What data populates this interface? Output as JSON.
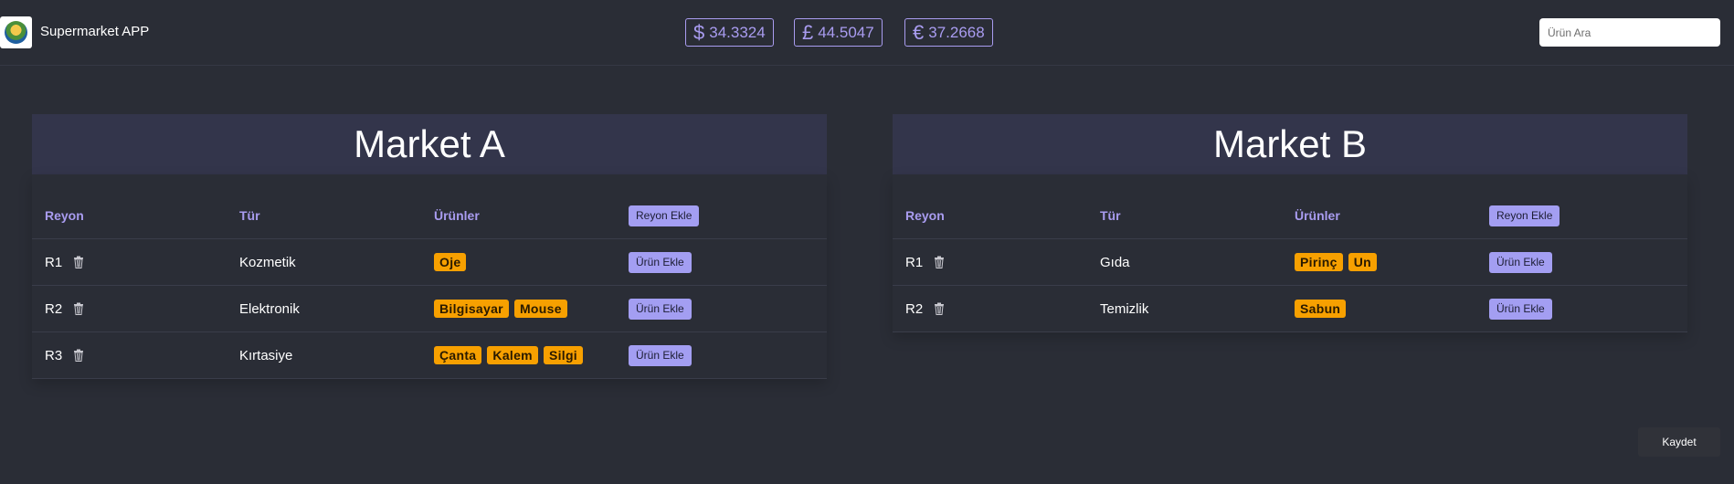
{
  "header": {
    "brand": "Supermarket APP",
    "logo_icon": "supermarket-logo-icon",
    "rates": [
      {
        "symbol": "$",
        "value": "34.3324",
        "icon": "dollar-icon"
      },
      {
        "symbol": "£",
        "value": "44.5047",
        "icon": "pound-icon"
      },
      {
        "symbol": "€",
        "value": "37.2668",
        "icon": "euro-icon"
      }
    ],
    "search_placeholder": "Ürün Ara"
  },
  "columns": {
    "reyon": "Reyon",
    "tur": "Tür",
    "urunler": "Ürünler",
    "add_reyon": "Reyon Ekle"
  },
  "add_product_label": "Ürün Ekle",
  "delete_icon": "trash-icon",
  "markets": [
    {
      "title": "Market A",
      "rows": [
        {
          "reyon": "R1",
          "tur": "Kozmetik",
          "products": [
            "Oje"
          ]
        },
        {
          "reyon": "R2",
          "tur": "Elektronik",
          "products": [
            "Bilgisayar",
            "Mouse"
          ]
        },
        {
          "reyon": "R3",
          "tur": "Kırtasiye",
          "products": [
            "Çanta",
            "Kalem",
            "Silgi"
          ]
        }
      ]
    },
    {
      "title": "Market B",
      "rows": [
        {
          "reyon": "R1",
          "tur": "Gıda",
          "products": [
            "Pirinç",
            "Un"
          ]
        },
        {
          "reyon": "R2",
          "tur": "Temizlik",
          "products": [
            "Sabun"
          ]
        }
      ]
    }
  ],
  "save_label": "Kaydet",
  "colors": {
    "background": "#2a2d36",
    "accent": "#a99cf0",
    "button": "#a39ef2",
    "tag": "#f7a000",
    "title_band": "#33354b"
  }
}
